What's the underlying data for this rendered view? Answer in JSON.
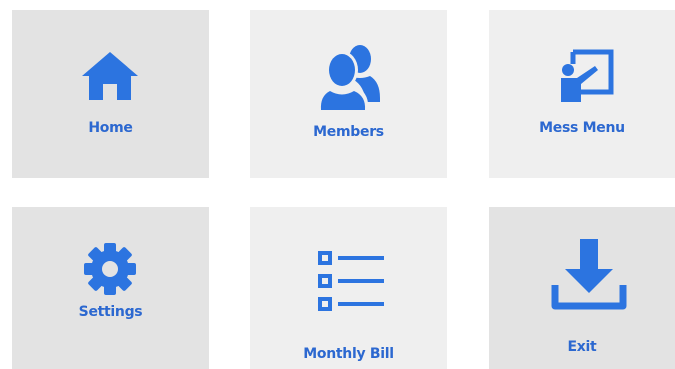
{
  "colors": {
    "accent": "#2c74e0",
    "label": "#2c68d0",
    "tile_light": "#efefef",
    "tile_dark": "#e3e3e3"
  },
  "tiles": [
    {
      "label": "Home",
      "icon": "home-icon"
    },
    {
      "label": "Members",
      "icon": "members-icon"
    },
    {
      "label": "Mess Menu",
      "icon": "presentation-board-icon"
    },
    {
      "label": "Settings",
      "icon": "gear-icon"
    },
    {
      "label": "Monthly Bill",
      "icon": "list-icon"
    },
    {
      "label": "Exit",
      "icon": "download-icon"
    }
  ]
}
